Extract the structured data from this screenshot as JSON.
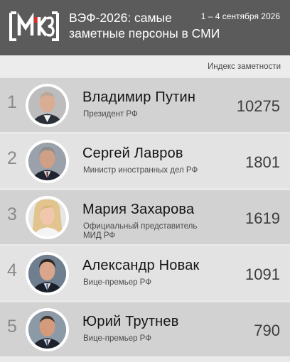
{
  "header": {
    "logo_text": "ММКЗ",
    "title_line1": "ВЭФ-2026: самые",
    "title_line2": "заметные персоны в СМИ",
    "date": "1 – 4 сентября 2026"
  },
  "column_label": "Индекс заметности",
  "rows": [
    {
      "rank": "1",
      "name": "Владимир Путин",
      "role_line1": "Президент РФ",
      "role_line2": "",
      "value": "10275"
    },
    {
      "rank": "2",
      "name": "Сергей Лавров",
      "role_line1": "Министр иностранных дел РФ",
      "role_line2": "",
      "value": "1801"
    },
    {
      "rank": "3",
      "name": "Мария Захарова",
      "role_line1": "Официальный представитель",
      "role_line2": "МИД РФ",
      "value": "1619"
    },
    {
      "rank": "4",
      "name": "Александр Новак",
      "role_line1": "Вице-премьер РФ",
      "role_line2": "",
      "value": "1091"
    },
    {
      "rank": "5",
      "name": "Юрий Трутнев",
      "role_line1": "Вице-премьер РФ",
      "role_line2": "",
      "value": "790"
    }
  ],
  "colors": {
    "header_bg": "#5b5b5b",
    "row_odd": "#d2d2d2",
    "row_even": "#e3e3e3"
  }
}
